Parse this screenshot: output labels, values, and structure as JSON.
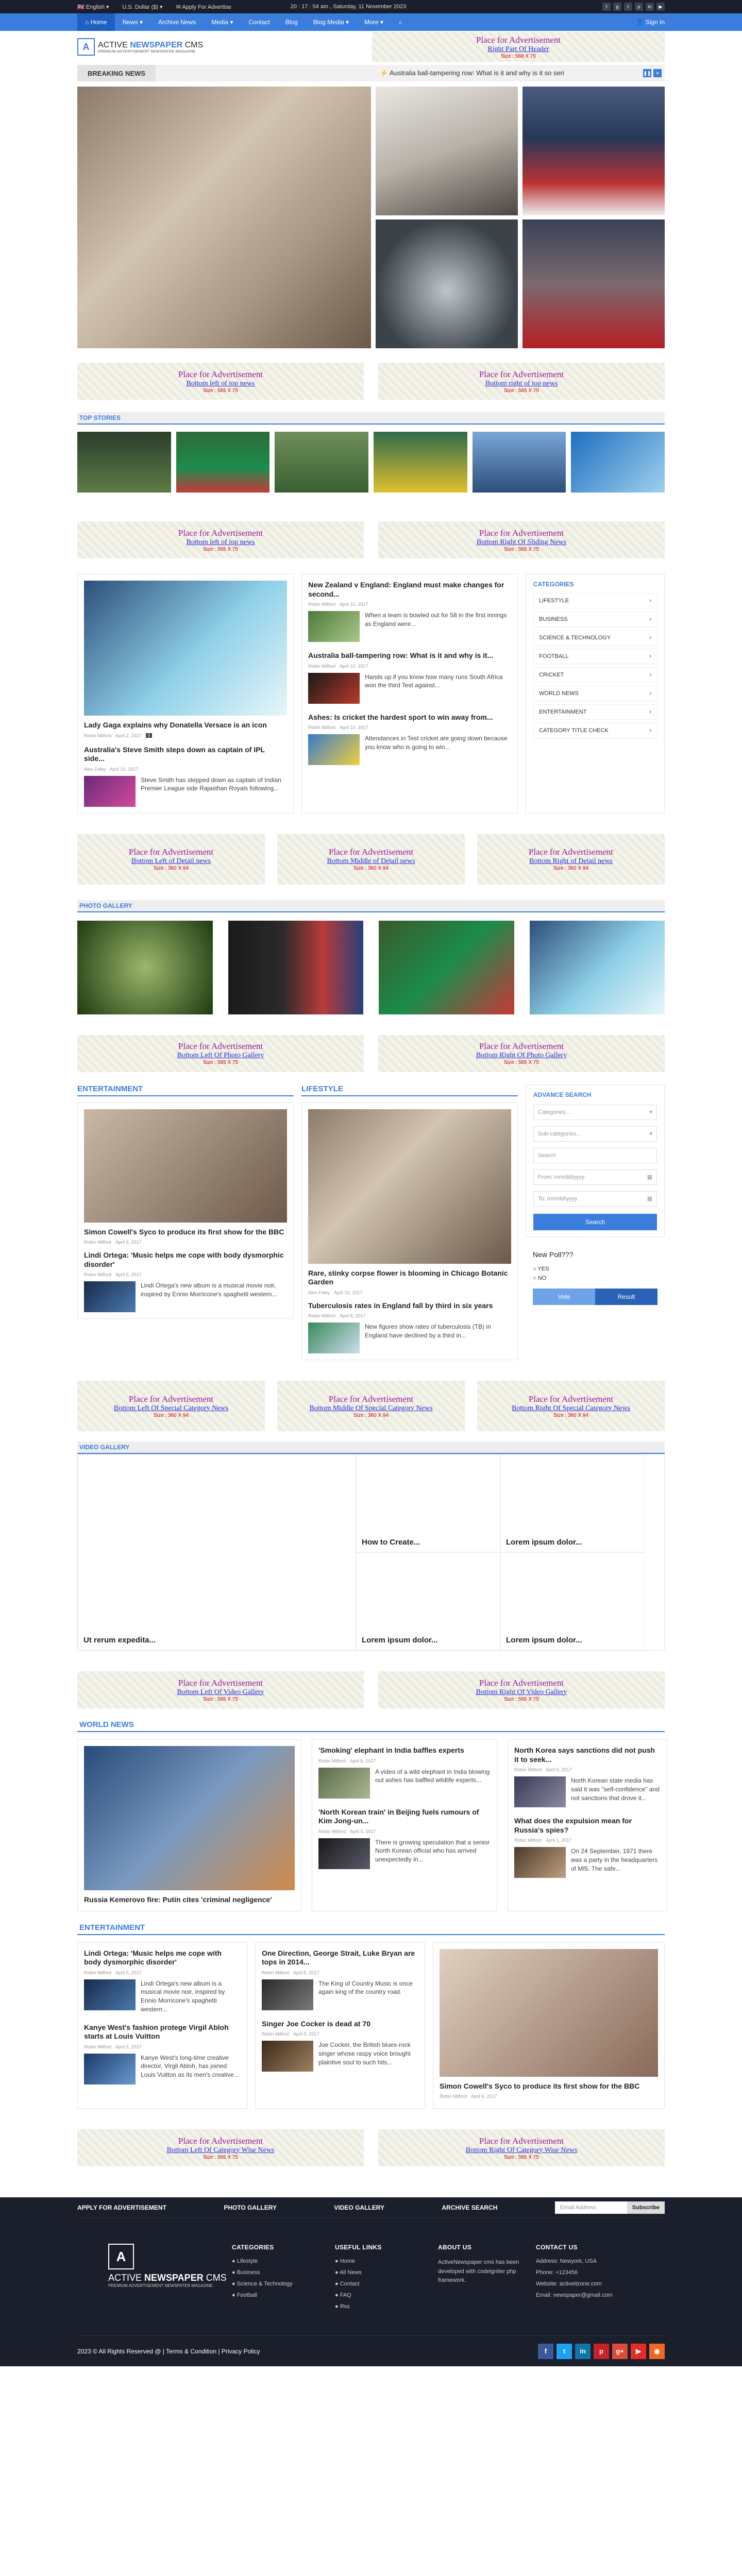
{
  "topbar": {
    "language": "English",
    "currency": "U.S. Dollar ($)",
    "apply": "Apply For Advertise",
    "datetime": "20 : 17 : 54 am , Saturday, 11 November 2023"
  },
  "nav": {
    "items": [
      "Home",
      "News",
      "Archive News",
      "Media",
      "Contact",
      "Blog",
      "Blog Media",
      "More"
    ],
    "signin": "Sign In"
  },
  "logo": {
    "t1a": "ACTIVE ",
    "t1b": "NEWSPAPER",
    "t1c": " CMS",
    "t2": "PREMIUM ADVERTISEMENT NEWSPATER MAGAZINE"
  },
  "ads": {
    "title": "Place for Advertisement",
    "header": {
      "sub": "Right Part Of Header",
      "size": "Size : 568 X 75"
    },
    "topleft": {
      "sub": "Bottom left of top news",
      "size": "Size : 565 X 75"
    },
    "topright": {
      "sub": "Bottom right of top news",
      "size": "Size : 565 X 75"
    },
    "slideleft": {
      "sub": "Bottom left of top news",
      "size": "Size : 565 X 75"
    },
    "slideright": {
      "sub": "Bottom Right Of Sliding News",
      "size": "Size : 565 X 75"
    },
    "detleft": {
      "sub": "Bottom Left of Detail news",
      "size": "Size : 360 X 94"
    },
    "detmid": {
      "sub": "Bottom Middle of Detail news",
      "size": "Size : 360 X 94"
    },
    "detright": {
      "sub": "Bottom Right of Detail news",
      "size": "Size : 360 X 94"
    },
    "photoleft": {
      "sub": "Bottom Left Of Photo Gallery",
      "size": "Size : 565 X 75"
    },
    "photoright": {
      "sub": "Bottom Right Of Photo Gallery",
      "size": "Size : 565 X 75"
    },
    "specleft": {
      "sub": "Bottom Left Of Special Category News",
      "size": "Size : 360 X 94"
    },
    "specmid": {
      "sub": "Bottom Middle Of Special Category News",
      "size": "Size : 360 X 94"
    },
    "specright": {
      "sub": "Bottom Right Of Special Category News",
      "size": "Size : 360 X 94"
    },
    "vidleft": {
      "sub": "Bottom Left Of Video Gallery",
      "size": "Size : 565 X 75"
    },
    "vidright": {
      "sub": "Bottom Right Of Video Gallery",
      "size": "Size : 565 X 75"
    },
    "catleft": {
      "sub": "Bottom Left Of Category Wise News",
      "size": "Size : 565 X 75"
    },
    "catright": {
      "sub": "Bottom Right Of Category Wise News",
      "size": "Size : 565 X 75"
    }
  },
  "breaking": {
    "label": "BREAKING NEWS",
    "text": "Australia ball-tampering row: What is it and why is it so seri"
  },
  "sections": {
    "top": "TOP STORIES",
    "photo": "PHOTO GALLERY",
    "video": "VIDEO GALLERY",
    "world": "WORLD NEWS",
    "entertainment": "ENTERTAINMENT",
    "lifestyle": "LIFESTYLE"
  },
  "news": {
    "lead": {
      "title": "Lady Gaga explains why Donatella Versace is an icon",
      "author": "Robin Milford",
      "date": "April 2, 2017"
    },
    "a2": {
      "title": "Australia's Steve Smith steps down as captain of IPL side...",
      "author": "Alex Foley",
      "date": "April 10, 2017",
      "excerpt": "Steve Smith has stepped down as captain of Indian Premier League side Rajasthan Royals following..."
    },
    "b1": {
      "title": "New Zealand v England: England must make changes for second...",
      "author": "Robin Milford",
      "date": "April 10, 2017",
      "excerpt": "When a team is bowled out for 58 in the first innings as England were..."
    },
    "b2": {
      "title": "Australia ball-tampering row: What is it and why is it...",
      "author": "Robin Milford",
      "date": "April 10, 2017",
      "excerpt": "Hands up if you know how many runs South Africa won the third Test against..."
    },
    "b3": {
      "title": "Ashes: Is cricket the hardest sport to win away from...",
      "author": "Robin Milford",
      "date": "April 10, 2017",
      "excerpt": "Attendances in Test cricket are going down because you know who is going to win..."
    }
  },
  "categories": {
    "title": "CATEGORIES",
    "items": [
      "LIFESTYLE",
      "BUSINESS",
      "SCIENCE & TECHNOLOGY",
      "FOOTBALL",
      "CRICKET",
      "WORLD NEWS",
      "ENTERTAINMENT",
      "CATEGORY TITLE CHECK"
    ]
  },
  "ent": {
    "e1": {
      "title": "Simon Cowell's Syco to produce its first show for the BBC",
      "author": "Robin Milford",
      "date": "April 6, 2017"
    },
    "e2": {
      "title": "Lindi Ortega: 'Music helps me cope with body dysmorphic disorder'",
      "author": "Robin Milford",
      "date": "April 5, 2017",
      "excerpt": "Lindi Ortega's new album is a musical movie noir, inspired by Ennio Morricone's spaghetti western..."
    },
    "l1": {
      "title": "Rare, stinky corpse flower is blooming in Chicago Botanic Garden",
      "author": "Alex Foley",
      "date": "April 10, 2017"
    },
    "l2": {
      "title": "Tuberculosis rates in England fall by third in six years",
      "author": "Robin Milford",
      "date": "April 8, 2017",
      "excerpt": "New figures show rates of tuberculosis (TB) in England have declined by a third in..."
    }
  },
  "search": {
    "title": "ADVANCE SEARCH",
    "cat": "Categories...",
    "sub": "Sub-categories...",
    "q": "Search",
    "from": "From:  mm/dd/yyyy",
    "to": "To:  mm/dd/yyyy",
    "btn": "Search"
  },
  "poll": {
    "q": "New Poll???",
    "yes": "YES",
    "no": "NO",
    "vote": "Vote",
    "result": "Result"
  },
  "video": {
    "v1": "Ut rerum expedita...",
    "v2": "How to Create...",
    "v3": "Lorem ipsum dolor...",
    "v4": "Lorem ipsum dolor...",
    "v5": "Lorem ipsum dolor..."
  },
  "world": {
    "lead": "Russia Kemerovo fire: Putin cites 'criminal negligence'",
    "w1": {
      "title": "'Smoking' elephant in India baffles experts",
      "author": "Robin Milford",
      "date": "April 6, 2017",
      "excerpt": "A video of a wild elephant in India blowing out ashes has baffled wildlife experts..."
    },
    "w2": {
      "title": "'North Korean train' in Beijing fuels rumours of Kim Jong-un...",
      "author": "Robin Milford",
      "date": "April 5, 2017",
      "excerpt": "There is growing speculation that a senior North Korean official who has arrived unexpectedly in..."
    },
    "w3": {
      "title": "North Korea says sanctions did not push it to seek...",
      "author": "Robin Milford",
      "date": "April 6, 2017",
      "excerpt": "North Korean state media has said it was \"self-confidence\" and not sanctions that drove it..."
    },
    "w4": {
      "title": "What does the expulsion mean for Russia's spies?",
      "author": "Robin Milford",
      "date": "April 1, 2017",
      "excerpt": "On 24 September, 1971 there was a party in the headquarters of MI5. The safe..."
    }
  },
  "ent2": {
    "a": {
      "title": "Lindi Ortega: 'Music helps me cope with body dysmorphic disorder'",
      "author": "Robin Milford",
      "date": "April 5, 2017",
      "excerpt": "Lindi Ortega's new album is a musical movie noir, inspired by Ennio Morricone's spaghetti western..."
    },
    "b": {
      "title": "Kanye West's fashion protege Virgil Abloh starts at Louis Vuitton",
      "author": "Robin Milford",
      "date": "April 5, 2017",
      "excerpt": "Kanye West's long-time creative director, Virgil Abloh, has joined Louis Vuitton as its men's creative..."
    },
    "c": {
      "title": "One Direction, George Strait, Luke Bryan are tops in 2014...",
      "author": "Robin Milford",
      "date": "April 5, 2017",
      "excerpt": "The King of Country Music is once again king of the country road."
    },
    "d": {
      "title": "Singer Joe Cocker is dead at 70",
      "author": "Robin Milford",
      "date": "April 5, 2017",
      "excerpt": "Joe Cocker, the British blues-rock singer whose raspy voice brought plaintive soul to such hits..."
    },
    "e": {
      "title": "Simon Cowell's Syco to produce its first show for the BBC",
      "author": "Robin Milford",
      "date": "April 6, 2017"
    }
  },
  "footer": {
    "bar": [
      "APPLY FOR ADVERTISEMENT",
      "PHOTO GALLERY",
      "VIDEO GALLERY",
      "ARCHIVE SEARCH"
    ],
    "email": "Email Address",
    "subscribe": "Subscribe",
    "cat_title": "CATEGORIES",
    "cats": [
      "Lifestyle",
      "Business",
      "Science & Technology",
      "Football"
    ],
    "links_title": "USEFUL LINKS",
    "links": [
      "Home",
      "All News",
      "Contact",
      "FAQ",
      "Rss"
    ],
    "about_title": "ABOUT US",
    "about": "ActiveNewspaper cms has been developed with codeigniter php framework.",
    "contact_title": "CONTACT US",
    "address": "Address: Newyork, USA",
    "phone": "Phone: +123456",
    "website": "Website: activeitzone.com",
    "mail": "Email: newspaper@gmail.com",
    "copyright": "2023 © All Rights Reserved @ | Terms & Condition | Privacy Policy"
  },
  "colors": {
    "accent": "#3b7ddd",
    "dark": "#1a1f2b"
  }
}
